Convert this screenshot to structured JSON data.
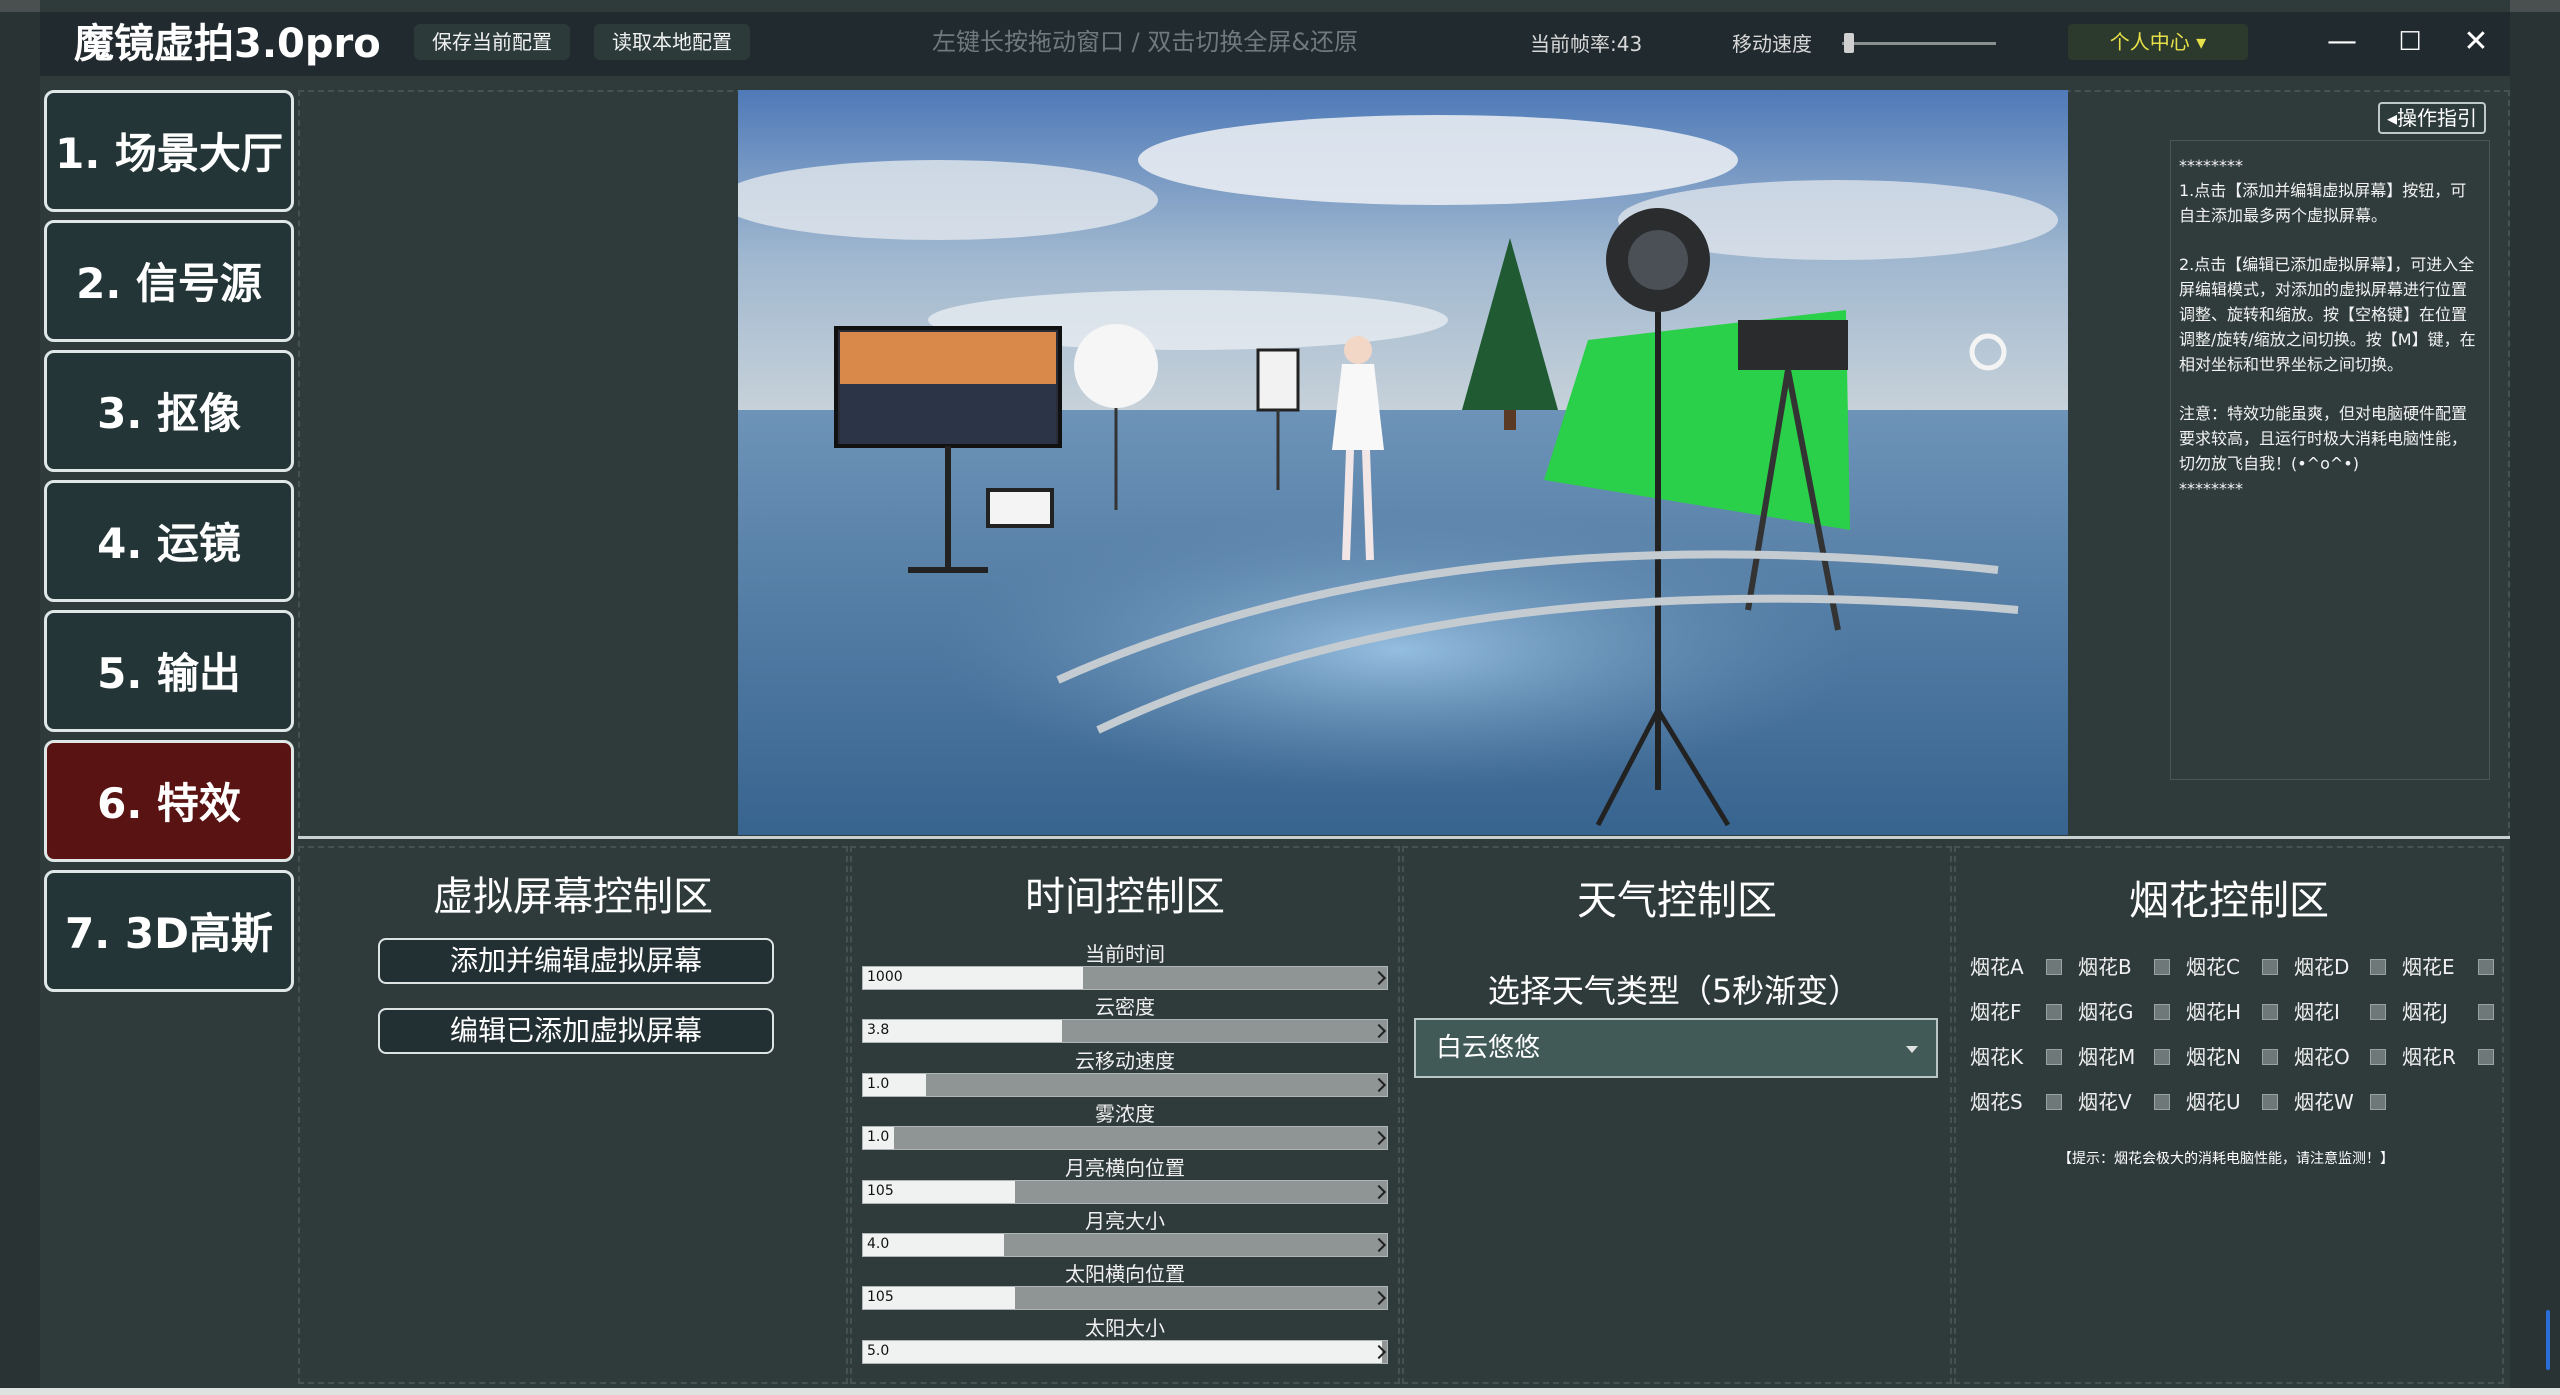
{
  "title": "魔镜虚拍3.0pro",
  "toolbar": {
    "save_config": "保存当前配置",
    "load_config": "读取本地配置",
    "hint": "左键长按拖动窗口 / 双击切换全屏&还原",
    "fps_label": "当前帧率:43",
    "speed_label": "移动速度",
    "speed_value": 0.02,
    "user_center": "个人中心 ▾",
    "minimize": "—",
    "maximize": "☐",
    "close": "✕"
  },
  "nav": [
    "1. 场景大厅",
    "2. 信号源",
    "3. 抠像",
    "4. 运镜",
    "5. 输出",
    "6. 特效",
    "7. 3D高斯"
  ],
  "nav_active_index": 5,
  "guide": {
    "button": "◂操作指引",
    "stars": "********",
    "p1": "1.点击【添加并编辑虚拟屏幕】按钮，可自主添加最多两个虚拟屏幕。",
    "p2": "2.点击【编辑已添加虚拟屏幕】，可进入全屏编辑模式，对添加的虚拟屏幕进行位置调整、旋转和缩放。按【空格键】在位置调整/旋转/缩放之间切换。按【M】键，在相对坐标和世界坐标之间切换。",
    "p3": "注意：特效功能虽爽，但对电脑硬件配置要求较高，且运行时极大消耗电脑性能，切勿放飞自我！(•^o^•)",
    "stars_end": "********"
  },
  "virtual_screen": {
    "title": "虚拟屏幕控制区",
    "add_button": "添加并编辑虚拟屏幕",
    "edit_button": "编辑已添加虚拟屏幕"
  },
  "time": {
    "title": "时间控制区",
    "sliders": [
      {
        "label": "当前时间",
        "value": "1000",
        "fraction": 0.42
      },
      {
        "label": "云密度",
        "value": "3.8",
        "fraction": 0.38
      },
      {
        "label": "云移动速度",
        "value": "1.0",
        "fraction": 0.12
      },
      {
        "label": "雾浓度",
        "value": "1.0",
        "fraction": 0.06
      },
      {
        "label": "月亮横向位置",
        "value": "105",
        "fraction": 0.29
      },
      {
        "label": "月亮大小",
        "value": "4.0",
        "fraction": 0.27
      },
      {
        "label": "太阳横向位置",
        "value": "105",
        "fraction": 0.29
      },
      {
        "label": "太阳大小",
        "value": "5.0",
        "fraction": 0.99
      }
    ]
  },
  "weather": {
    "title": "天气控制区",
    "subtitle": "选择天气类型（5秒渐变）",
    "selected": "白云悠悠"
  },
  "fireworks": {
    "title": "烟花控制区",
    "items": [
      "烟花A",
      "烟花B",
      "烟花C",
      "烟花D",
      "烟花E",
      "烟花F",
      "烟花G",
      "烟花H",
      "烟花I",
      "烟花J",
      "烟花K",
      "烟花M",
      "烟花N",
      "烟花O",
      "烟花R",
      "烟花S",
      "烟花V",
      "烟花U",
      "烟花W"
    ],
    "tip": "【提示：烟花会极大的消耗电脑性能，请注意监测！】"
  }
}
